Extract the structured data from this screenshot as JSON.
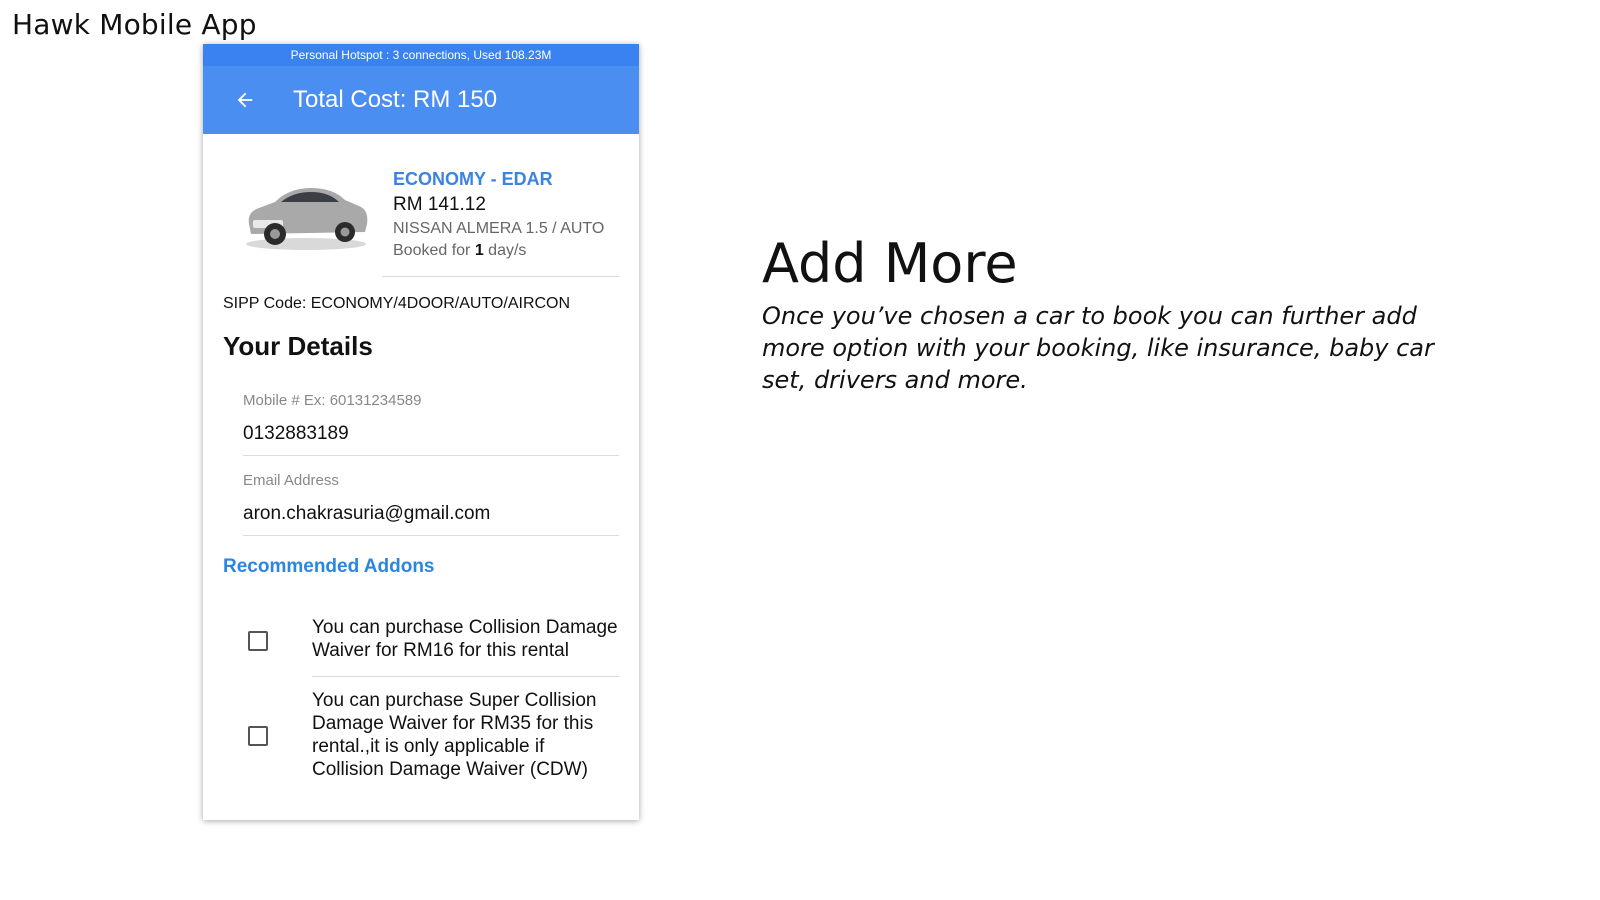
{
  "slide": {
    "title": "Hawk Mobile App",
    "heading": "Add More",
    "description": "Once you’ve chosen a car to book you can further add more option with your booking, like insurance, baby car set, drivers and more."
  },
  "phone": {
    "status_bar": "Personal Hotspot : 3 connections, Used 108.23M",
    "app_bar_title": "Total Cost: RM 150",
    "back_icon": "arrow-back-icon",
    "car": {
      "image_icon": "car-image",
      "class": "ECONOMY - EDAR",
      "price": "RM 141.12",
      "model": "NISSAN ALMERA 1.5 / AUTO",
      "booked_prefix": "Booked for ",
      "booked_days": "1",
      "booked_suffix": " day/s"
    },
    "sipp": "SIPP Code: ECONOMY/4DOOR/AUTO/AIRCON",
    "details_title": "Your Details",
    "mobile": {
      "label": "Mobile # Ex: 60131234589",
      "value": "0132883189"
    },
    "email": {
      "label": "Email Address",
      "value": "aron.chakrasuria@gmail.com"
    },
    "addons_title": "Recommended Addons",
    "addons": [
      {
        "text": "You can purchase Collision Damage Waiver for RM16 for this rental",
        "checked": false
      },
      {
        "text": "You can purchase Super Collision Damage Waiver for RM35 for this rental.,it is only applicable if Collision Damage Waiver (CDW)",
        "checked": false
      }
    ]
  },
  "colors": {
    "app_bar": "#4a8ef2",
    "status_bar": "#3a82f0",
    "accent": "#3b82e6"
  }
}
